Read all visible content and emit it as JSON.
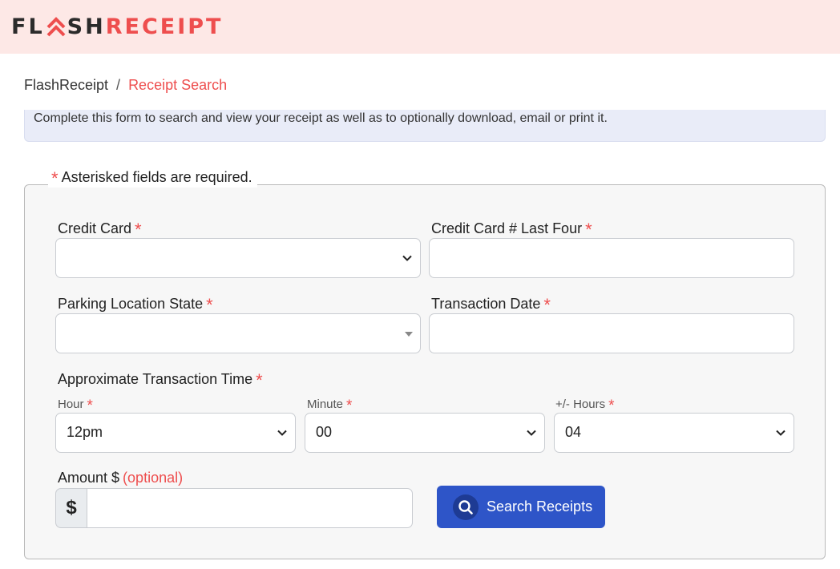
{
  "header": {
    "logo": {
      "part1": "FL",
      "part2": "SH",
      "part3": "RECEIPT",
      "brand_dark": "#2b2b2b",
      "brand_red": "#ee4e4e"
    }
  },
  "breadcrumb": {
    "root": "FlashReceipt",
    "separator": "/",
    "current": "Receipt Search"
  },
  "info_text": "Complete this form to search and view your receipt as well as to optionally download, email or print it.",
  "form": {
    "required_marker": "*",
    "required_note": "Asterisked fields are required.",
    "credit_card": {
      "label": "Credit Card",
      "value": ""
    },
    "last_four": {
      "label": "Credit Card # Last Four",
      "value": ""
    },
    "state": {
      "label": "Parking Location State",
      "value": ""
    },
    "transaction_date": {
      "label": "Transaction Date",
      "value": ""
    },
    "approx_time": {
      "label": "Approximate Transaction Time",
      "hour": {
        "label": "Hour",
        "value": "12pm"
      },
      "minute": {
        "label": "Minute",
        "value": "00"
      },
      "hours_range": {
        "label": "+/- Hours",
        "value": "04"
      }
    },
    "amount": {
      "label": "Amount $",
      "optional": "(optional)",
      "prefix": "$",
      "value": ""
    },
    "search_button": {
      "label": "Search Receipts",
      "icon": "search-icon",
      "color": "#2e55c8"
    }
  }
}
